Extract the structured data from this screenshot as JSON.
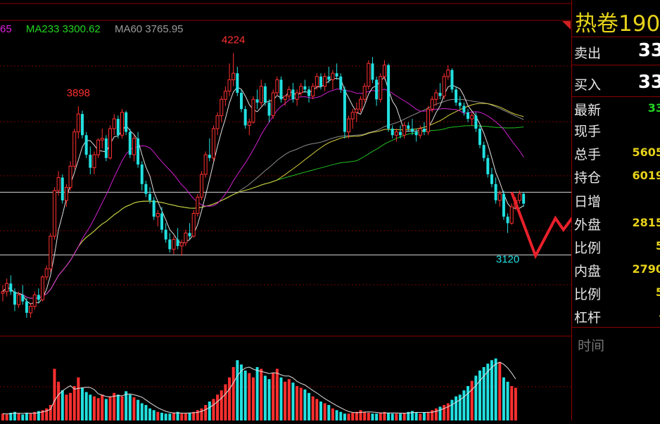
{
  "legend": [
    {
      "label": "65",
      "color": "#e020e0"
    },
    {
      "label": "MA233 3300.62",
      "color": "#22d422"
    },
    {
      "label": "MA60 3765.95",
      "color": "#9a9a9a"
    }
  ],
  "symbol": "热卷190",
  "quote_rows": [
    {
      "label": "卖出",
      "value": "33",
      "color": "#ffffff"
    },
    {
      "label": "买入",
      "value": "33",
      "color": "#ffffff"
    },
    {
      "label": "最新",
      "value": "33",
      "color": "#22d422"
    },
    {
      "label": "现手",
      "value": "",
      "color": "#e6d21a"
    },
    {
      "label": "总手",
      "value": "5605",
      "color": "#e6d21a"
    },
    {
      "label": "持仓",
      "value": "6019",
      "color": "#e6d21a"
    },
    {
      "label": "日增",
      "value": "",
      "color": "#e6d21a"
    },
    {
      "label": "外盘",
      "value": "2815",
      "color": "#e6d21a"
    },
    {
      "label": "比例",
      "value": "5",
      "color": "#e6d21a"
    },
    {
      "label": "内盘",
      "value": "2790",
      "color": "#e6d21a"
    },
    {
      "label": "比例",
      "value": "5",
      "color": "#e6d21a"
    },
    {
      "label": "杠杆",
      "value": "-",
      "color": "#e6d21a"
    }
  ],
  "time_label": "时间",
  "chart_data": {
    "type": "candlestick",
    "annotations": [
      {
        "text": "3898",
        "index": 19,
        "price": 3898,
        "color": "#ff3030"
      },
      {
        "text": "4224",
        "index": 58,
        "price": 4224,
        "color": "#ff3030"
      },
      {
        "text": "3120",
        "index": 127,
        "price": 3120,
        "color": "#22e0e0"
      }
    ],
    "reference_levels": [
      3370,
      2985
    ],
    "price_range": [
      2500,
      4420
    ],
    "projection_arrow": {
      "from_index": 128,
      "to_index": 149,
      "points": [
        [
          128,
          3370
        ],
        [
          134,
          2980
        ],
        [
          139,
          3210
        ],
        [
          141,
          3140
        ],
        [
          149,
          3400
        ]
      ],
      "color": "#e8202a"
    },
    "candles": [
      [
        2750,
        2800,
        2700,
        2760
      ],
      [
        2760,
        2840,
        2730,
        2810
      ],
      [
        2810,
        2860,
        2740,
        2760
      ],
      [
        2760,
        2780,
        2640,
        2680
      ],
      [
        2680,
        2760,
        2660,
        2740
      ],
      [
        2740,
        2800,
        2680,
        2700
      ],
      [
        2700,
        2720,
        2600,
        2630
      ],
      [
        2630,
        2690,
        2600,
        2670
      ],
      [
        2670,
        2760,
        2650,
        2740
      ],
      [
        2740,
        2780,
        2690,
        2710
      ],
      [
        2710,
        2860,
        2700,
        2850
      ],
      [
        2850,
        2920,
        2830,
        2900
      ],
      [
        2900,
        3120,
        2880,
        3100
      ],
      [
        3100,
        3400,
        3080,
        3380
      ],
      [
        3380,
        3500,
        3350,
        3460
      ],
      [
        3460,
        3480,
        3300,
        3320
      ],
      [
        3320,
        3420,
        3280,
        3400
      ],
      [
        3400,
        3560,
        3380,
        3530
      ],
      [
        3530,
        3760,
        3510,
        3740
      ],
      [
        3740,
        3898,
        3700,
        3850
      ],
      [
        3850,
        3870,
        3700,
        3720
      ],
      [
        3720,
        3740,
        3580,
        3600
      ],
      [
        3600,
        3650,
        3480,
        3520
      ],
      [
        3520,
        3620,
        3480,
        3600
      ],
      [
        3600,
        3700,
        3580,
        3690
      ],
      [
        3690,
        3760,
        3640,
        3700
      ],
      [
        3700,
        3720,
        3560,
        3580
      ],
      [
        3580,
        3780,
        3570,
        3760
      ],
      [
        3760,
        3850,
        3720,
        3820
      ],
      [
        3820,
        3840,
        3700,
        3720
      ],
      [
        3720,
        3880,
        3700,
        3860
      ],
      [
        3860,
        3870,
        3720,
        3740
      ],
      [
        3740,
        3760,
        3580,
        3600
      ],
      [
        3600,
        3720,
        3560,
        3700
      ],
      [
        3700,
        3740,
        3520,
        3540
      ],
      [
        3540,
        3560,
        3380,
        3420
      ],
      [
        3420,
        3440,
        3340,
        3360
      ],
      [
        3360,
        3400,
        3300,
        3320
      ],
      [
        3320,
        3340,
        3200,
        3220
      ],
      [
        3220,
        3260,
        3160,
        3240
      ],
      [
        3240,
        3280,
        3120,
        3140
      ],
      [
        3140,
        3180,
        3060,
        3080
      ],
      [
        3080,
        3120,
        3000,
        3020
      ],
      [
        3020,
        3100,
        2990,
        3080
      ],
      [
        3080,
        3150,
        3020,
        3040
      ],
      [
        3040,
        3080,
        2980,
        3060
      ],
      [
        3060,
        3140,
        3040,
        3120
      ],
      [
        3120,
        3180,
        3080,
        3100
      ],
      [
        3100,
        3260,
        3090,
        3240
      ],
      [
        3240,
        3360,
        3220,
        3340
      ],
      [
        3340,
        3500,
        3320,
        3480
      ],
      [
        3480,
        3620,
        3460,
        3600
      ],
      [
        3600,
        3700,
        3560,
        3580
      ],
      [
        3580,
        3780,
        3560,
        3760
      ],
      [
        3760,
        3860,
        3720,
        3840
      ],
      [
        3840,
        3960,
        3800,
        3940
      ],
      [
        3940,
        4020,
        3900,
        3990
      ],
      [
        3990,
        4160,
        3960,
        4060
      ],
      [
        4060,
        4224,
        4020,
        4100
      ],
      [
        4100,
        4140,
        3960,
        3980
      ],
      [
        3980,
        4000,
        3860,
        3880
      ],
      [
        3880,
        3900,
        3760,
        3780
      ],
      [
        3780,
        3820,
        3720,
        3800
      ],
      [
        3800,
        3960,
        3790,
        3940
      ],
      [
        3940,
        4000,
        3880,
        3920
      ],
      [
        3920,
        4060,
        3900,
        4020
      ],
      [
        4020,
        4040,
        3900,
        3920
      ],
      [
        3920,
        3940,
        3800,
        3840
      ],
      [
        3840,
        4000,
        3820,
        3980
      ],
      [
        3980,
        4080,
        3960,
        4060
      ],
      [
        4060,
        4080,
        3920,
        3940
      ],
      [
        3940,
        3960,
        3900,
        3960
      ],
      [
        3960,
        4020,
        3940,
        4000
      ],
      [
        4000,
        4040,
        3920,
        3940
      ],
      [
        3940,
        4000,
        3900,
        3980
      ],
      [
        3980,
        4040,
        3960,
        4020
      ],
      [
        4020,
        4060,
        3980,
        4000
      ],
      [
        4000,
        4020,
        3920,
        3960
      ],
      [
        3960,
        4040,
        3940,
        4020
      ],
      [
        4020,
        4100,
        4000,
        4080
      ],
      [
        4080,
        4100,
        4000,
        4020
      ],
      [
        4020,
        4100,
        3990,
        4080
      ],
      [
        4080,
        4140,
        4040,
        4060
      ],
      [
        4060,
        4120,
        4000,
        4100
      ],
      [
        4100,
        4160,
        4060,
        4080
      ],
      [
        4080,
        4100,
        3980,
        4000
      ],
      [
        4000,
        4020,
        3700,
        3740
      ],
      [
        3740,
        3840,
        3700,
        3820
      ],
      [
        3820,
        3880,
        3760,
        3860
      ],
      [
        3860,
        3920,
        3800,
        3880
      ],
      [
        3880,
        3960,
        3860,
        3940
      ],
      [
        3940,
        4040,
        3920,
        4020
      ],
      [
        4020,
        4180,
        4000,
        4160
      ],
      [
        4160,
        4200,
        4040,
        4060
      ],
      [
        4060,
        4080,
        3900,
        3940
      ],
      [
        3940,
        4100,
        3920,
        4080
      ],
      [
        4080,
        4180,
        4060,
        4150
      ],
      [
        4150,
        4160,
        3740,
        3760
      ],
      [
        3760,
        3780,
        3700,
        3720
      ],
      [
        3720,
        3760,
        3680,
        3740
      ],
      [
        3740,
        3780,
        3700,
        3720
      ],
      [
        3720,
        3800,
        3700,
        3780
      ],
      [
        3780,
        3800,
        3740,
        3760
      ],
      [
        3760,
        3820,
        3720,
        3740
      ],
      [
        3740,
        3760,
        3680,
        3720
      ],
      [
        3720,
        3780,
        3700,
        3760
      ],
      [
        3760,
        3800,
        3720,
        3740
      ],
      [
        3740,
        3900,
        3720,
        3880
      ],
      [
        3880,
        3960,
        3860,
        3940
      ],
      [
        3940,
        4000,
        3900,
        3980
      ],
      [
        3980,
        4040,
        3940,
        3960
      ],
      [
        3960,
        4100,
        3940,
        4080
      ],
      [
        4080,
        4150,
        4060,
        4120
      ],
      [
        4120,
        4130,
        3980,
        4000
      ],
      [
        4000,
        4020,
        3900,
        3920
      ],
      [
        3920,
        3960,
        3880,
        3900
      ],
      [
        3900,
        3920,
        3840,
        3860
      ],
      [
        3860,
        3880,
        3800,
        3820
      ],
      [
        3820,
        3860,
        3780,
        3840
      ],
      [
        3840,
        3860,
        3740,
        3760
      ],
      [
        3760,
        3780,
        3640,
        3660
      ],
      [
        3660,
        3680,
        3560,
        3580
      ],
      [
        3580,
        3600,
        3460,
        3480
      ],
      [
        3480,
        3520,
        3400,
        3420
      ],
      [
        3420,
        3460,
        3300,
        3320
      ],
      [
        3320,
        3380,
        3280,
        3360
      ],
      [
        3360,
        3380,
        3200,
        3220
      ],
      [
        3220,
        3240,
        3120,
        3180
      ],
      [
        3180,
        3300,
        3170,
        3280
      ],
      [
        3280,
        3340,
        3260,
        3320
      ],
      [
        3320,
        3380,
        3300,
        3360
      ],
      [
        3360,
        3370,
        3280,
        3300
      ]
    ],
    "volume": [
      8,
      7,
      9,
      10,
      8,
      7,
      9,
      8,
      10,
      11,
      12,
      14,
      18,
      60,
      45,
      35,
      30,
      32,
      40,
      50,
      38,
      33,
      30,
      28,
      26,
      30,
      25,
      28,
      32,
      30,
      28,
      34,
      30,
      27,
      24,
      20,
      18,
      14,
      12,
      10,
      9,
      8,
      8,
      9,
      10,
      8,
      8,
      9,
      10,
      12,
      14,
      18,
      22,
      25,
      30,
      35,
      42,
      50,
      62,
      70,
      65,
      58,
      55,
      50,
      62,
      60,
      52,
      48,
      55,
      60,
      50,
      45,
      48,
      44,
      40,
      38,
      36,
      32,
      28,
      25,
      22,
      20,
      18,
      14,
      12,
      10,
      8,
      8,
      9,
      10,
      12,
      10,
      9,
      8,
      8,
      9,
      10,
      9,
      8,
      8,
      8,
      9,
      10,
      11,
      9,
      8,
      9,
      10,
      12,
      14,
      16,
      18,
      20,
      24,
      28,
      30,
      35,
      40,
      46,
      52,
      58,
      62,
      66,
      70,
      72,
      68,
      50,
      45,
      40,
      38
    ],
    "volume_max": 80
  }
}
